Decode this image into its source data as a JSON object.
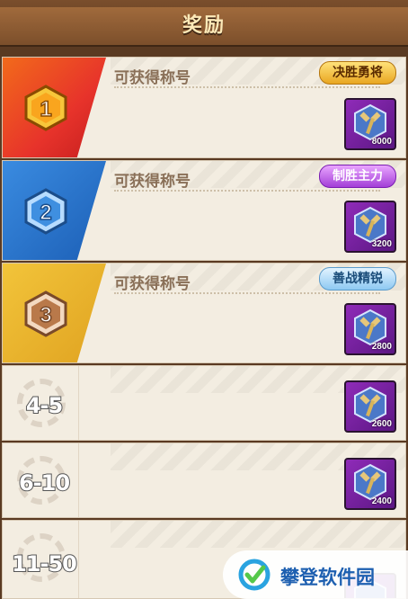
{
  "header": {
    "title": "奖励"
  },
  "ranks": [
    {
      "rank": "1",
      "label": "可获得称号",
      "title": "决胜勇将",
      "reward_count": "8000"
    },
    {
      "rank": "2",
      "label": "可获得称号",
      "title": "制胜主力",
      "reward_count": "3200"
    },
    {
      "rank": "3",
      "label": "可获得称号",
      "title": "善战精锐",
      "reward_count": "2800"
    }
  ],
  "ranges": [
    {
      "range": "4-5",
      "reward_count": "2600"
    },
    {
      "range": "6-10",
      "reward_count": "2400"
    },
    {
      "range": "11-50",
      "reward_count": ""
    }
  ],
  "watermark": {
    "text": "攀登软件园"
  },
  "icons": {
    "rank1": "gold-hexagon-medal-icon",
    "rank2": "blue-hexagon-medal-icon",
    "rank3": "bronze-hexagon-medal-icon",
    "reward": "hammer-item-icon",
    "range": "gear-icon",
    "watermark": "checkmark-logo-icon"
  },
  "colors": {
    "rank1": "#e7332b",
    "rank2": "#1c5fb6",
    "rank3": "#e0a321",
    "reward_bg": "#8f2bb8"
  }
}
